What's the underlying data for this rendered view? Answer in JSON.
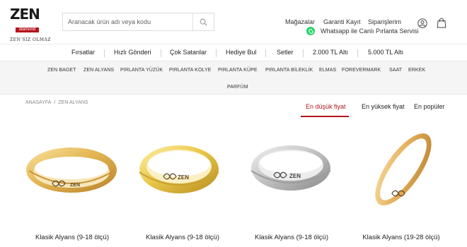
{
  "brand": {
    "name": "ZEN",
    "sub": "diamond",
    "tagline": "ZEN'SİZ OLMAZ"
  },
  "search": {
    "placeholder": "Aranacak ürün adı veya kodu"
  },
  "header_links": {
    "stores": "Mağazalar",
    "warranty": "Garanti Kayıt",
    "orders": "Siparişlerim",
    "whatsapp": "Whatsapp ile Canlı Pırlanta Servisi"
  },
  "topnav": [
    "Fırsatlar",
    "Hızlı Gönderi",
    "Çok Satanlar",
    "Hediye Bul",
    "Setler",
    "2.000 TL Altı",
    "5.000 TL Altı"
  ],
  "categories": [
    "ZEN BAGET",
    "ZEN ALYANS",
    "PIRLANTA YÜZÜK",
    "PIRLANTA KOLYE",
    "PIRLANTA KÜPE",
    "PIRLANTA BİLEKLİK",
    "ELMAS",
    "FOREVERMARK",
    "SAAT",
    "ERKEK",
    "PARFÜM"
  ],
  "breadcrumb": [
    "ANASAYFA",
    "ZEN ALYANS"
  ],
  "sort": {
    "lowest": "En düşük fiyat",
    "highest": "En yüksek fiyat",
    "popular": "En popüler",
    "active_color": "#b3151c"
  },
  "products": [
    {
      "name": "Klasik Alyans (9-18 ölçü)",
      "metal": "yellow-gold"
    },
    {
      "name": "Klasik Alyans (9-18 ölçü)",
      "metal": "yellow-gold"
    },
    {
      "name": "Klasik Alyans (9-18 ölçü)",
      "metal": "white-gold"
    },
    {
      "name": "Klasik Alyans (19-28 ölçü)",
      "metal": "yellow-gold"
    }
  ],
  "ring_engraving": "ZEN",
  "icons": [
    "search-icon",
    "whatsapp-icon",
    "user-icon",
    "shopping-bag-icon",
    "infinity-icon"
  ],
  "colors": {
    "accent": "#b3151c",
    "whatsapp": "#25d366",
    "category_band": "#f5f5f5"
  }
}
